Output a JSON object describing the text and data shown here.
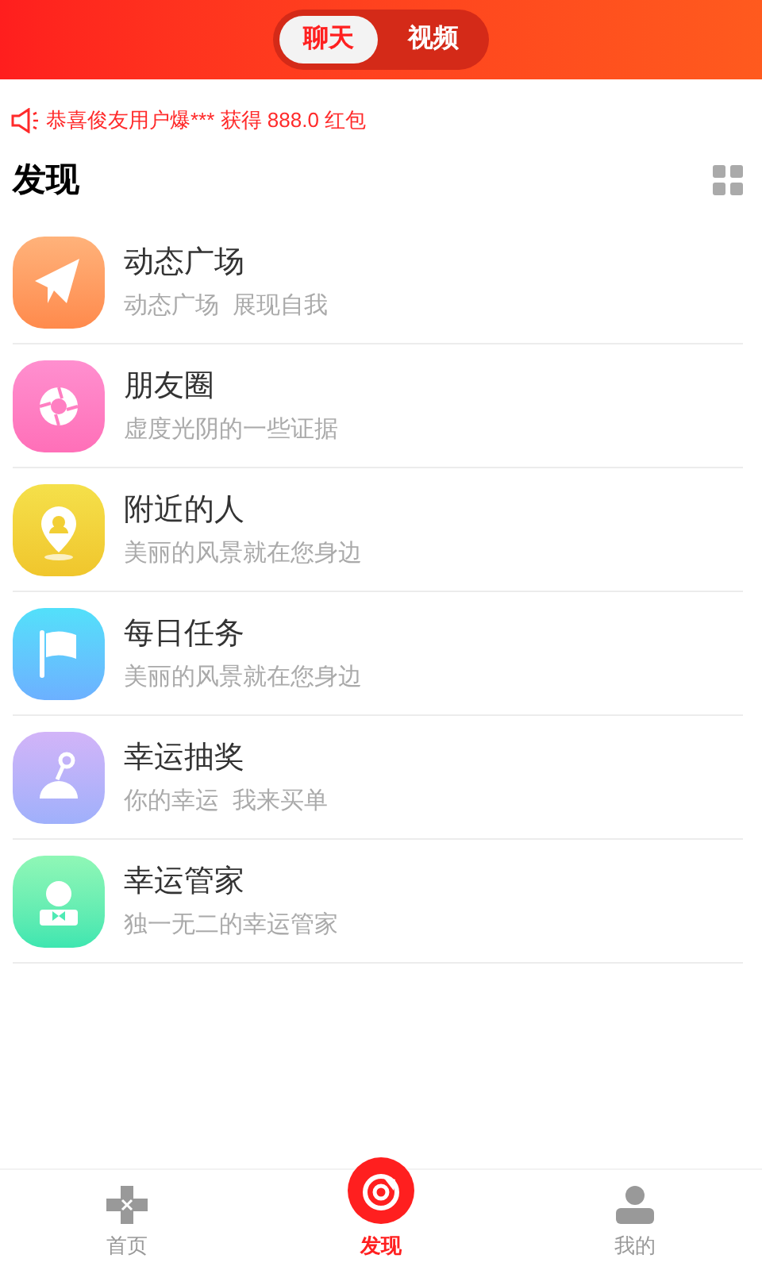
{
  "header_tabs": [
    {
      "label": "聊天",
      "selected": true
    },
    {
      "label": "视频",
      "selected": false
    }
  ],
  "notice": "恭喜俊友用户爆*** 获得 888.0 红包",
  "section_title": "发现",
  "items": [
    {
      "kind": "plane",
      "title": "动态广场",
      "subtitle": "动态广场  展现自我"
    },
    {
      "kind": "shutter",
      "title": "朋友圈",
      "subtitle": "虚度光阴的一些证据"
    },
    {
      "kind": "pin",
      "title": "附近的人",
      "subtitle": "美丽的风景就在您身边"
    },
    {
      "kind": "flag",
      "title": "每日任务",
      "subtitle": "美丽的风景就在您身边"
    },
    {
      "kind": "joystick",
      "title": "幸运抽奖",
      "subtitle": "你的幸运  我来买单"
    },
    {
      "kind": "butler",
      "title": "幸运管家",
      "subtitle": "独一无二的幸运管家"
    }
  ],
  "bottom_nav": [
    {
      "kind": "home",
      "label": "首页",
      "selected": false
    },
    {
      "kind": "discover",
      "label": "发现",
      "selected": true
    },
    {
      "kind": "profile",
      "label": "我的",
      "selected": false
    }
  ]
}
